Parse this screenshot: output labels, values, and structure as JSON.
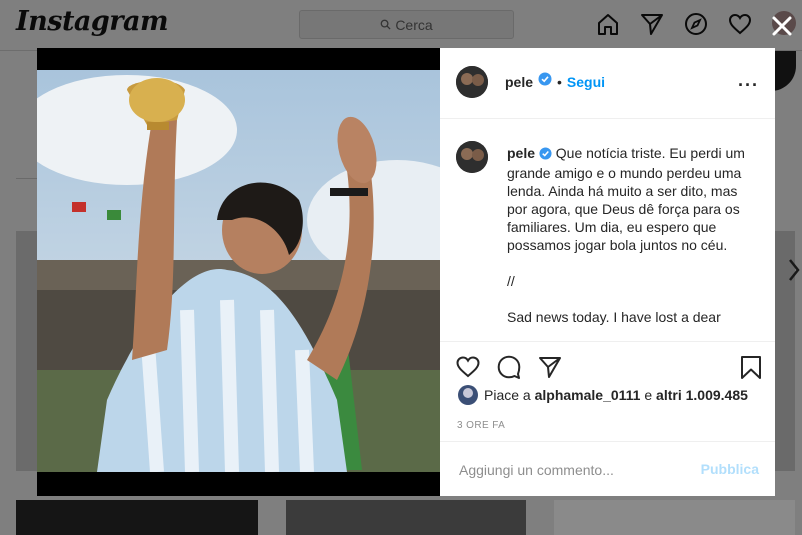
{
  "header": {
    "logo": "Instagram",
    "search_placeholder": "Cerca",
    "nav_icons": [
      "home-icon",
      "direct-icon",
      "explore-icon",
      "activity-icon",
      "profile-avatar"
    ]
  },
  "post": {
    "username": "pele",
    "follow_label": "Segui",
    "caption_username": "pele",
    "caption_text": "Que notícia triste. Eu perdi um grande amigo e o mundo perdeu uma lenda. Ainda há muito a ser dito, mas por agora, que Deus dê força para os familiares. Um dia, eu espero que possamos jogar bola juntos no céu.",
    "caption_sep": "//",
    "caption_en": "Sad news today. I have lost a dear",
    "likes_prefix": "Piace a ",
    "likes_user": "alphamale_0111",
    "likes_mid": " e ",
    "likes_others": "altri 1.009.485",
    "timestamp": "3 ORE FA",
    "comment_placeholder": "Aggiungi un commento...",
    "publish_label": "Pubblica"
  },
  "colors": {
    "accent": "#0095f6",
    "publish_disabled": "#b2dffc",
    "verified": "#3897f0"
  }
}
